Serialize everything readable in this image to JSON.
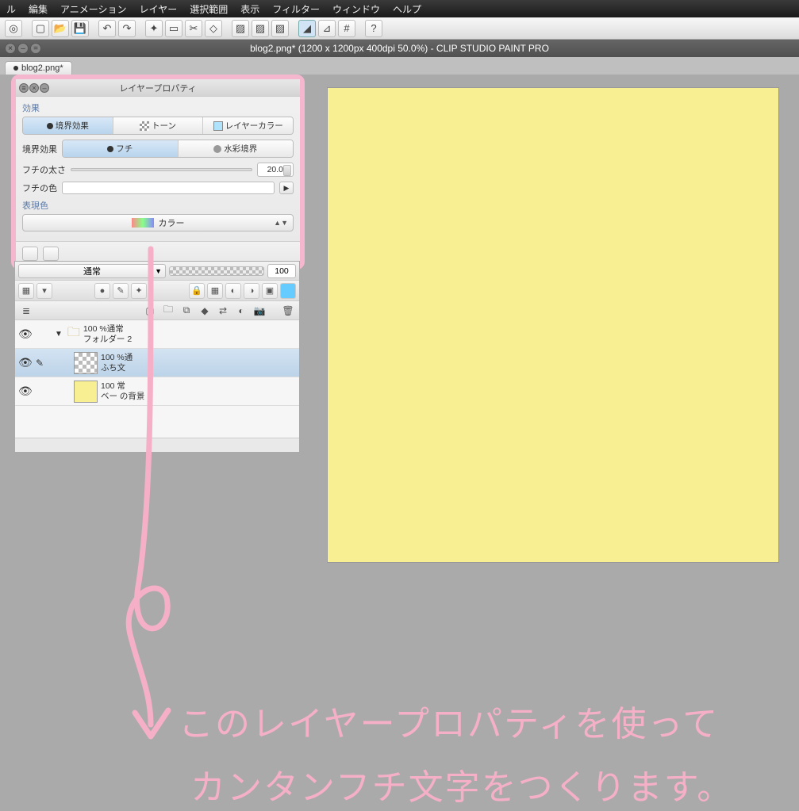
{
  "menu": {
    "items": [
      "ル",
      "編集",
      "アニメーション",
      "レイヤー",
      "選択範囲",
      "表示",
      "フィルター",
      "ウィンドウ",
      "ヘルプ"
    ]
  },
  "doc": {
    "title": "blog2.png* (1200 x 1200px 400dpi 50.0%)  - CLIP STUDIO PAINT PRO",
    "tab": "blog2.png*"
  },
  "prop": {
    "title": "レイヤープロパティ",
    "effect_label": "効果",
    "pill_border": "境界効果",
    "pill_tone": "トーン",
    "pill_layercolor": "レイヤーカラー",
    "border_label": "境界効果",
    "pill_fuchi": "フチ",
    "pill_suisai": "水彩境界",
    "thickness_label": "フチの太さ",
    "thickness_value": "20.0",
    "color_label": "フチの色",
    "express_label": "表現色",
    "combo_label": "カラー"
  },
  "layers": {
    "blend_mode": "通常",
    "opacity": "100",
    "folder": {
      "opacity_line": "100 %通常",
      "name": "フォルダー 2"
    },
    "l1": {
      "opacity_line": "100 %通",
      "name": "ふち文"
    },
    "l2": {
      "opacity_line": "100  常",
      "name": "ベー   の背景"
    }
  },
  "annotation": {
    "line1": "このレイヤープロパティを使って",
    "line2": "カンタンフチ文字をつくります。"
  }
}
